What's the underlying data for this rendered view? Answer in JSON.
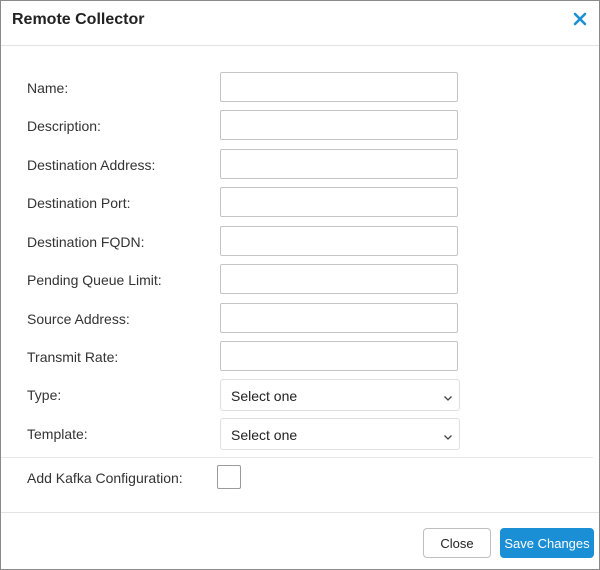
{
  "dialog": {
    "title": "Remote Collector",
    "close_icon": "close-x-icon",
    "accent_color": "#1b8fd6"
  },
  "form": {
    "fields": [
      {
        "label": "Name:",
        "value": ""
      },
      {
        "label": "Description:",
        "value": ""
      },
      {
        "label": "Destination Address:",
        "value": ""
      },
      {
        "label": "Destination Port:",
        "value": ""
      },
      {
        "label": "Destination FQDN:",
        "value": ""
      },
      {
        "label": "Pending Queue Limit:",
        "value": ""
      },
      {
        "label": "Source Address:",
        "value": ""
      },
      {
        "label": "Transmit Rate:",
        "value": ""
      }
    ],
    "selects": [
      {
        "label": "Type:",
        "value": "Select one"
      },
      {
        "label": "Template:",
        "value": "Select one"
      }
    ],
    "kafka": {
      "label": "Add Kafka Configuration:",
      "checked": false
    }
  },
  "footer": {
    "close_label": "Close",
    "save_label": "Save Changes"
  }
}
